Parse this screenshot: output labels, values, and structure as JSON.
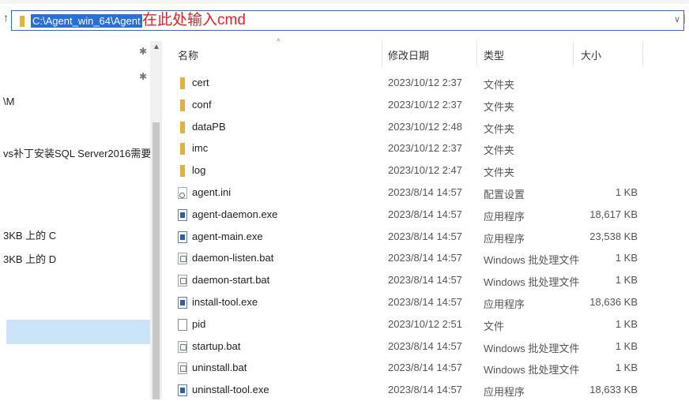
{
  "address_bar": {
    "path": "C:\\Agent_win_64\\Agent",
    "annotation": "在此处输入cmd",
    "dropdown_icon": "chevron-down-icon"
  },
  "nav": {
    "items": [
      {
        "label": "\\M"
      },
      {
        "label": "vs补丁安装SQL Server2016需要"
      },
      {
        "label": "3KB 上的 C"
      },
      {
        "label": "3KB 上的 D"
      }
    ]
  },
  "columns": {
    "name": "名称",
    "date": "修改日期",
    "type": "类型",
    "size": "大小"
  },
  "files": [
    {
      "name": "cert",
      "date": "2023/10/12 2:37",
      "type": "文件夹",
      "size": "",
      "icon": "folder-icon"
    },
    {
      "name": "conf",
      "date": "2023/10/12 2:37",
      "type": "文件夹",
      "size": "",
      "icon": "folder-icon"
    },
    {
      "name": "dataPB",
      "date": "2023/10/12 2:48",
      "type": "文件夹",
      "size": "",
      "icon": "folder-icon"
    },
    {
      "name": "imc",
      "date": "2023/10/12 2:37",
      "type": "文件夹",
      "size": "",
      "icon": "folder-icon"
    },
    {
      "name": "log",
      "date": "2023/10/12 2:47",
      "type": "文件夹",
      "size": "",
      "icon": "folder-icon"
    },
    {
      "name": "agent.ini",
      "date": "2023/8/14 14:57",
      "type": "配置设置",
      "size": "1 KB",
      "icon": "ini-file-icon"
    },
    {
      "name": "agent-daemon.exe",
      "date": "2023/8/14 14:57",
      "type": "应用程序",
      "size": "18,617 KB",
      "icon": "exe-file-icon"
    },
    {
      "name": "agent-main.exe",
      "date": "2023/8/14 14:57",
      "type": "应用程序",
      "size": "23,538 KB",
      "icon": "exe-file-icon"
    },
    {
      "name": "daemon-listen.bat",
      "date": "2023/8/14 14:57",
      "type": "Windows 批处理文件",
      "size": "1 KB",
      "icon": "bat-file-icon"
    },
    {
      "name": "daemon-start.bat",
      "date": "2023/8/14 14:57",
      "type": "Windows 批处理文件",
      "size": "1 KB",
      "icon": "bat-file-icon"
    },
    {
      "name": "install-tool.exe",
      "date": "2023/8/14 14:57",
      "type": "应用程序",
      "size": "18,636 KB",
      "icon": "exe-file-icon"
    },
    {
      "name": "pid",
      "date": "2023/10/12 2:51",
      "type": "文件",
      "size": "1 KB",
      "icon": "file-icon"
    },
    {
      "name": "startup.bat",
      "date": "2023/8/14 14:57",
      "type": "Windows 批处理文件",
      "size": "1 KB",
      "icon": "bat-file-icon"
    },
    {
      "name": "uninstall.bat",
      "date": "2023/8/14 14:57",
      "type": "Windows 批处理文件",
      "size": "1 KB",
      "icon": "bat-file-icon"
    },
    {
      "name": "uninstall-tool.exe",
      "date": "2023/8/14 14:57",
      "type": "应用程序",
      "size": "18,633 KB",
      "icon": "exe-file-icon"
    }
  ],
  "colors": {
    "address_highlight": "#2a6fd6",
    "annotation": "#e6202a",
    "folder": "#e3b23c",
    "nav_selected": "#cce4f7"
  }
}
